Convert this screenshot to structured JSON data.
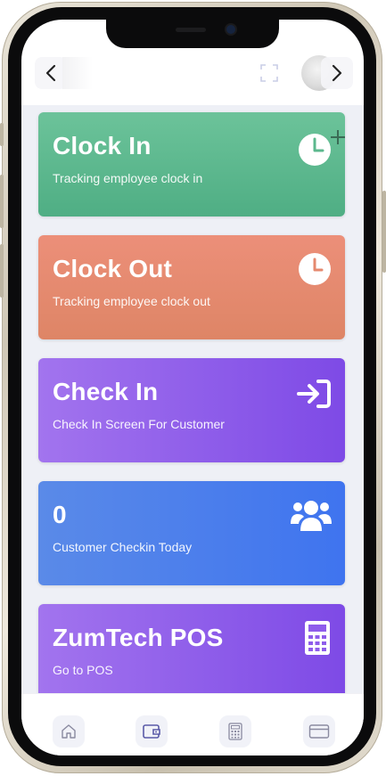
{
  "cards": {
    "clock_in": {
      "title": "Clock In",
      "subtitle": "Tracking employee clock in",
      "icon": "clock-plus-icon"
    },
    "clock_out": {
      "title": "Clock Out",
      "subtitle": "Tracking employee clock out",
      "icon": "clock-icon"
    },
    "check_in": {
      "title": "Check In",
      "subtitle": "Check In Screen For Customer",
      "icon": "sign-in-icon"
    },
    "customer_count": {
      "title": "0",
      "subtitle": "Customer Checkin Today",
      "icon": "users-icon"
    },
    "pos": {
      "title": "ZumTech POS",
      "subtitle": "Go to POS",
      "icon": "calculator-icon"
    }
  },
  "icons": {
    "top": [
      "chevron-left-icon",
      "fullscreen-icon",
      "avatar",
      "chevron-right-icon"
    ],
    "bottom_tabs": [
      "home-icon",
      "wallet-icon",
      "calculator-icon",
      "card-icon"
    ]
  },
  "colors": {
    "clock_in": "#5cb88e",
    "clock_out": "#e5896f",
    "purple": "#8f5deb",
    "blue": "#4a7fec",
    "tab_icon": "#5b5ba8"
  }
}
